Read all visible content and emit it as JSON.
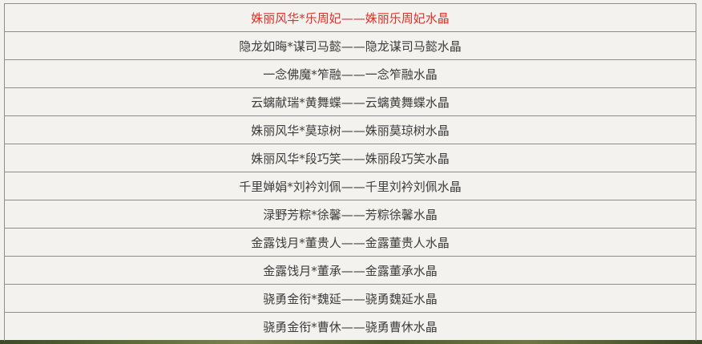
{
  "table": {
    "rows": [
      "姝丽风华*乐周妃——姝丽乐周妃水晶",
      "隐龙如晦*谋司马懿——隐龙谋司马懿水晶",
      "一念佛魔*笮融——一念笮融水晶",
      "云螭献瑞*黄舞蝶——云螭黄舞蝶水晶",
      "姝丽风华*莫琼树——姝丽莫琼树水晶",
      "姝丽风华*段巧笑——姝丽段巧笑水晶",
      "千里婵娟*刘衿刘佩——千里刘衿刘佩水晶",
      "渌野芳粽*徐馨——芳粽徐馨水晶",
      "金露饯月*董贵人——金露董贵人水晶",
      "金露饯月*董承——金露董承水晶",
      "骁勇金衔*魏延——骁勇魏延水晶",
      "骁勇金衔*曹休——骁勇曹休水晶"
    ]
  },
  "colors": {
    "highlight_text": "#d7322b",
    "normal_text": "#3c3c3c",
    "row_background": "#f3f2ef",
    "border": "#8d8d8d"
  }
}
